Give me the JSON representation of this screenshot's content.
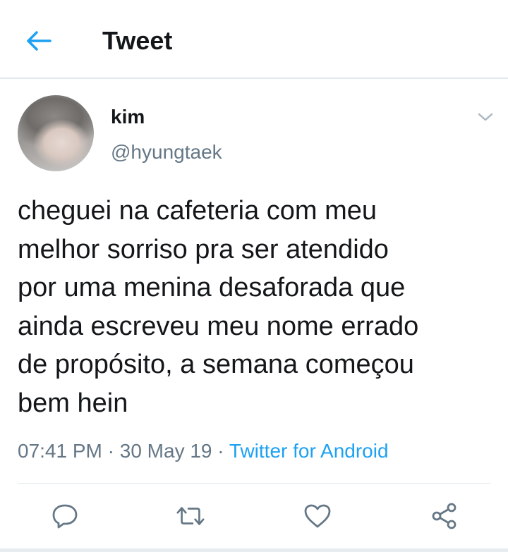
{
  "header": {
    "back_icon": "arrow-left-icon",
    "title": "Tweet"
  },
  "tweet": {
    "avatar_alt": "profile photo",
    "display_name": "kim",
    "handle": "@hyungtaek",
    "text": "cheguei na cafeteria com meu melhor sorriso pra ser atendido por uma menina desaforada que ainda escreveu meu nome errado de propósito, a semana começou bem hein",
    "lines": [
      "cheguei na cafeteria com meu",
      "melhor sorriso pra ser atendido",
      "por uma menina desaforada que",
      "ainda escreveu meu nome errado",
      "de propósito, a semana começou",
      "bem hein"
    ],
    "time": "07:41 PM",
    "separator": "·",
    "date": "30 May 19",
    "source": "Twitter for Android"
  },
  "actions": [
    {
      "name": "reply",
      "icon": "reply-icon"
    },
    {
      "name": "retweet",
      "icon": "retweet-icon"
    },
    {
      "name": "like",
      "icon": "heart-icon"
    },
    {
      "name": "share",
      "icon": "share-icon"
    }
  ],
  "colors": {
    "accent": "#1da1f2",
    "text_primary": "#14171a",
    "text_secondary": "#657786",
    "divider": "#e1e8ed"
  }
}
